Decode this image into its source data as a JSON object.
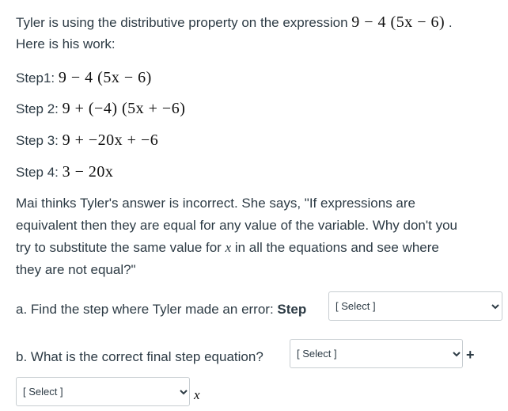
{
  "intro": {
    "text": "Tyler is using the distributive property on the expression ",
    "expression": "9 − 4 (5x − 6)",
    "after": " .",
    "line2": "Here is his work:"
  },
  "steps": [
    {
      "label": "Step1: ",
      "expression": "9 − 4 (5x − 6)"
    },
    {
      "label": "Step 2: ",
      "expression": "9 + (−4) (5x + −6)"
    },
    {
      "label": "Step 3: ",
      "expression": "9 + −20x + −6"
    },
    {
      "label": "Step 4: ",
      "expression": "3 − 20x"
    }
  ],
  "mai": {
    "line1": "Mai thinks Tyler's answer is incorrect.  She says, \"If expressions are",
    "line2": "equivalent then they are equal for any value of the variable.  Why don't you",
    "line3_before": "try to substitute the same value for ",
    "line3_var": "x",
    "line3_after": " in all the equations and see where",
    "line4": "they are not equal?\""
  },
  "question_a": {
    "text": "a. Find the step where Tyler made an error: ",
    "bold": "Step",
    "select_value": "[ Select ]"
  },
  "question_b": {
    "text": "b. What is the correct final step equation?",
    "select1_value": "[ Select ]",
    "plus": "+",
    "select2_value": "[ Select ]",
    "var": "x"
  }
}
